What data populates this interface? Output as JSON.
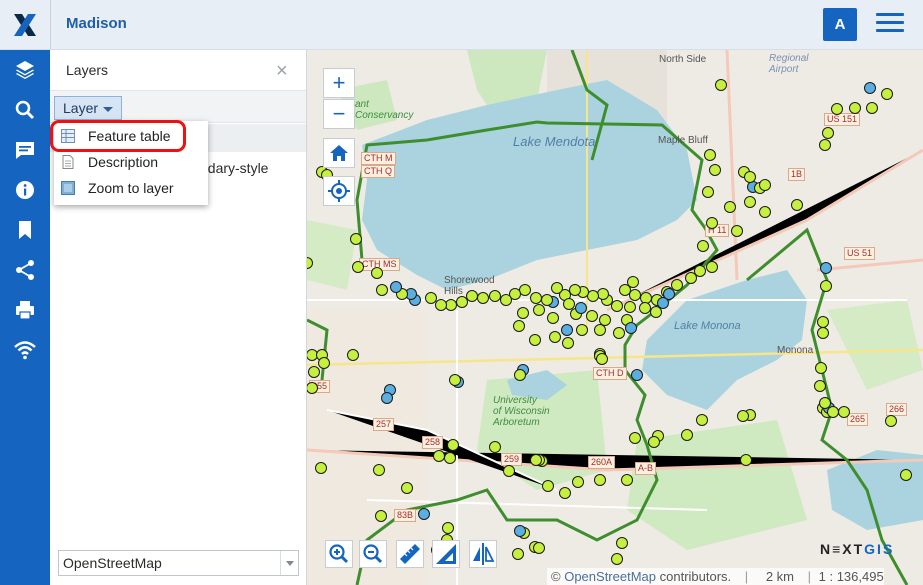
{
  "app": {
    "title": "Madison",
    "user_initial": "A"
  },
  "sidebar": {
    "items": [
      {
        "icon": "layers-icon"
      },
      {
        "icon": "search-icon"
      },
      {
        "icon": "chat-icon"
      },
      {
        "icon": "info-icon"
      },
      {
        "icon": "bookmark-icon"
      },
      {
        "icon": "share-icon"
      },
      {
        "icon": "print-icon"
      },
      {
        "icon": "wifi-icon"
      }
    ]
  },
  "panel": {
    "title": "Layers",
    "close_symbol": "×",
    "layer_button_label": "Layer",
    "tree_partial_text": "ndary-style",
    "basemap_selected": "OpenStreetMap"
  },
  "dropdown": {
    "items": [
      {
        "label": "Feature table",
        "icon": "table-icon"
      },
      {
        "label": "Description",
        "icon": "document-icon"
      },
      {
        "label": "Zoom to layer",
        "icon": "zoom-to-layer-icon"
      }
    ]
  },
  "map": {
    "labels": {
      "north_side": "North Side",
      "regional_airport": "Regional\nAirport",
      "lake_mendota": "Lake Mendota",
      "maple_bluff": "Maple Bluff",
      "shorewood_hills": "Shorewood\nHills",
      "lake_monona": "Lake Monona",
      "monona": "Monona",
      "uw_arboretum": "University\nof Wisconsin\nArboretum",
      "conservancy": "ant\nConservancy"
    },
    "shields": {
      "cth_m": "CTH M",
      "cth_q": "CTH Q",
      "cth_ms": "CTH MS",
      "us_151": "US 151",
      "us_51": "US 51",
      "cth_d": "CTH D",
      "h11": "H 11",
      "r1b": "1B",
      "r255": "255",
      "r257": "257",
      "r258": "258",
      "r259": "259",
      "r260a": "260A",
      "r265": "265",
      "r266": "266",
      "r83b": "83B",
      "rab": "A-B"
    },
    "attribution": {
      "copyright": "©",
      "osm_link": "OpenStreetMap",
      "contributors": "contributors.",
      "scale_bar": "2 km",
      "scale_ratio": "1 : 136,495"
    },
    "logo": {
      "next": "N≡XT",
      "gis": "GIS"
    }
  },
  "colors": {
    "brand": "#1565c0",
    "water": "#aad3df",
    "boundary": "#3e8e2e",
    "point_green": "#c6f03f",
    "point_blue": "#5aaee0",
    "highlight": "#e11111"
  }
}
